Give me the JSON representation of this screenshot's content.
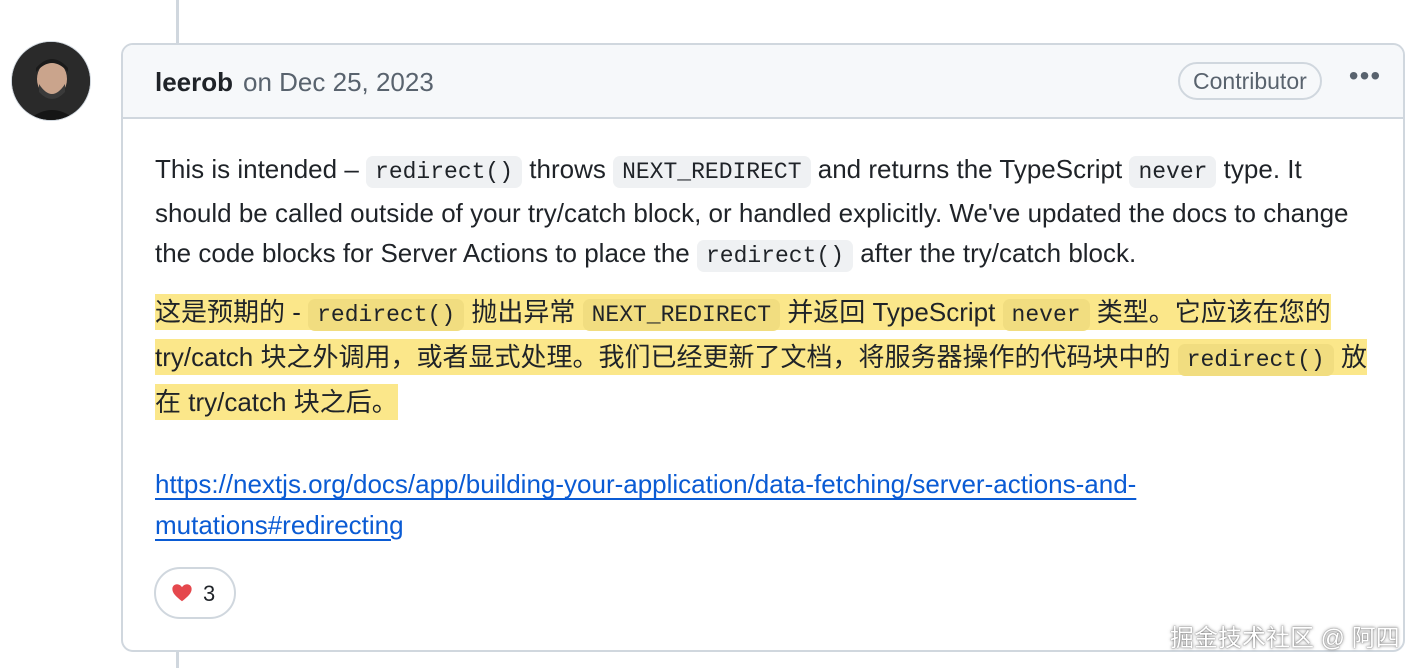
{
  "comment": {
    "author": "leerob",
    "date": "on Dec 25, 2023",
    "role_badge": "Contributor",
    "more_label": "•••",
    "body_en": {
      "t1": "This is intended – ",
      "c1": "redirect()",
      "t2": " throws ",
      "c2": "NEXT_REDIRECT",
      "t3": " and returns the TypeScript ",
      "c3": "never",
      "t4": " type. It should be called outside of your try/catch block, or handled explicitly. We've updated the docs to change the code blocks for Server Actions to place the ",
      "c4": "redirect()",
      "t5": " after the try/catch block."
    },
    "body_zh": {
      "t1": "这是预期的 - ",
      "c1": "redirect()",
      "t2": " 抛出异常 ",
      "c2": "NEXT_REDIRECT",
      "t3": " 并返回 TypeScript ",
      "c3": "never",
      "t4": " 类型。它应该在您的 try/catch 块之外调用，或者显式处理。我们已经更新了文档，将服务器操作的代码块中的 ",
      "c4": "redirect()",
      "t5": " 放在 try/catch 块之后。"
    },
    "link": "https://nextjs.org/docs/app/building-your-application/data-fetching/server-actions-and-mutations#redirecting",
    "reaction": {
      "icon": "heart-icon",
      "count": "3"
    }
  },
  "watermark": "掘金技术社区 @ 阿四",
  "colors": {
    "border": "#d0d7de",
    "header_bg": "#f6f8fa",
    "link": "#0a5bd4",
    "highlight": "#fbe78a",
    "code_bg": "#eff1f3",
    "heart": "#e5484d"
  }
}
